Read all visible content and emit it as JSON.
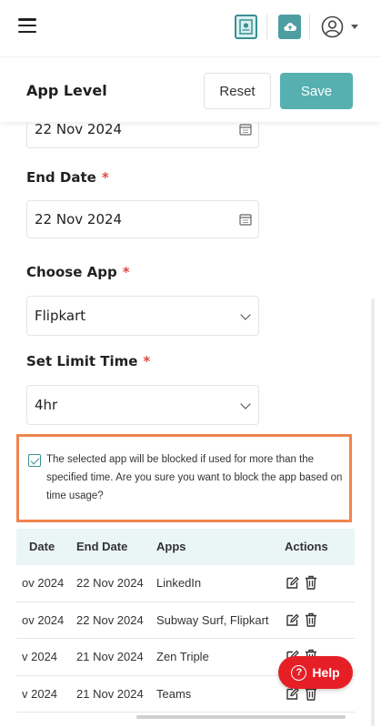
{
  "nav": {
    "menu_icon": "hamburger-icon",
    "icons": [
      "settings-document-icon",
      "cloud-upload-icon",
      "user-avatar-icon",
      "caret-down-icon"
    ],
    "accent_color": "#56b0b0"
  },
  "header": {
    "title": "App Level",
    "reset_label": "Reset",
    "save_label": "Save"
  },
  "form": {
    "start_date_value": "22 Nov 2024",
    "end_date_label": "End Date",
    "end_date_value": "22 Nov 2024",
    "choose_app_label": "Choose App",
    "choose_app_value": "Flipkart",
    "limit_label": "Set Limit Time",
    "limit_value": "4hr",
    "required_mark": "*",
    "confirm_checked": true,
    "confirm_text": "The selected app will be blocked if used for more than the specified time. Are you sure you want to block the app based on time usage?"
  },
  "table": {
    "headers": [
      "Date",
      "End Date",
      "Apps",
      "Actions"
    ],
    "rows": [
      {
        "start": "ov 2024",
        "end": "22 Nov 2024",
        "apps": "LinkedIn"
      },
      {
        "start": "ov 2024",
        "end": "22 Nov 2024",
        "apps": "Subway Surf, Flipkart"
      },
      {
        "start": "v 2024",
        "end": "21 Nov 2024",
        "apps": "Zen Triple"
      },
      {
        "start": "v 2024",
        "end": "21 Nov 2024",
        "apps": "Teams"
      }
    ]
  },
  "help": {
    "label": "Help",
    "color": "#e61f27"
  },
  "highlight_color": "#f0844e"
}
